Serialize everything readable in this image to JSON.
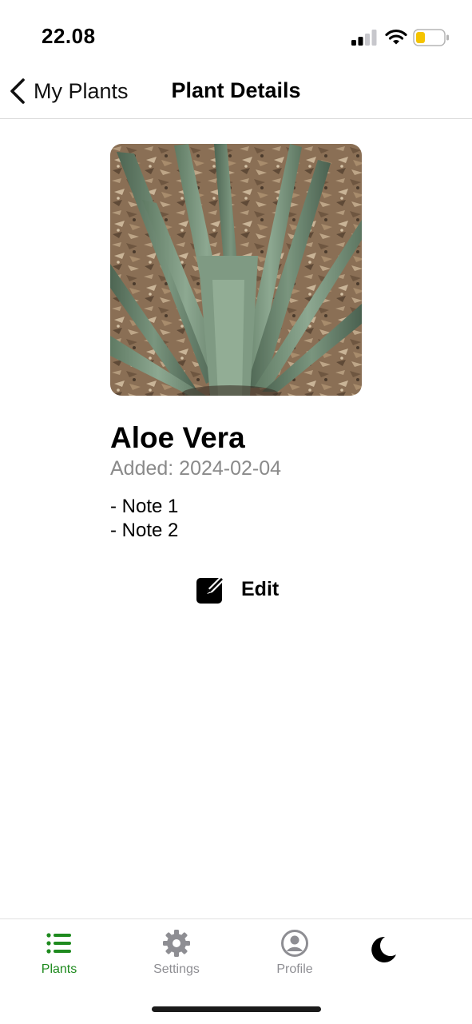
{
  "status_bar": {
    "time": "22.08",
    "icons": [
      "cellular-signal-icon",
      "wifi-icon",
      "battery-icon"
    ]
  },
  "nav": {
    "back_label": "My Plants",
    "title": "Plant Details"
  },
  "plant": {
    "name": "Aloe Vera",
    "added": "Added: 2024-02-04",
    "notes": [
      "- Note 1",
      "- Note 2"
    ],
    "edit_label": "Edit"
  },
  "tabs": [
    {
      "label": "Plants",
      "icon": "list-icon",
      "active": true
    },
    {
      "label": "Settings",
      "icon": "gear-icon",
      "active": false
    },
    {
      "label": "Profile",
      "icon": "person-circle-icon",
      "active": false
    }
  ],
  "theme_toggle_icon": "moon-icon",
  "colors": {
    "accent": "#1e8a1e",
    "inactive": "#8e8e93",
    "battery": "#f5c400",
    "subtitle": "#8a8a8a"
  }
}
